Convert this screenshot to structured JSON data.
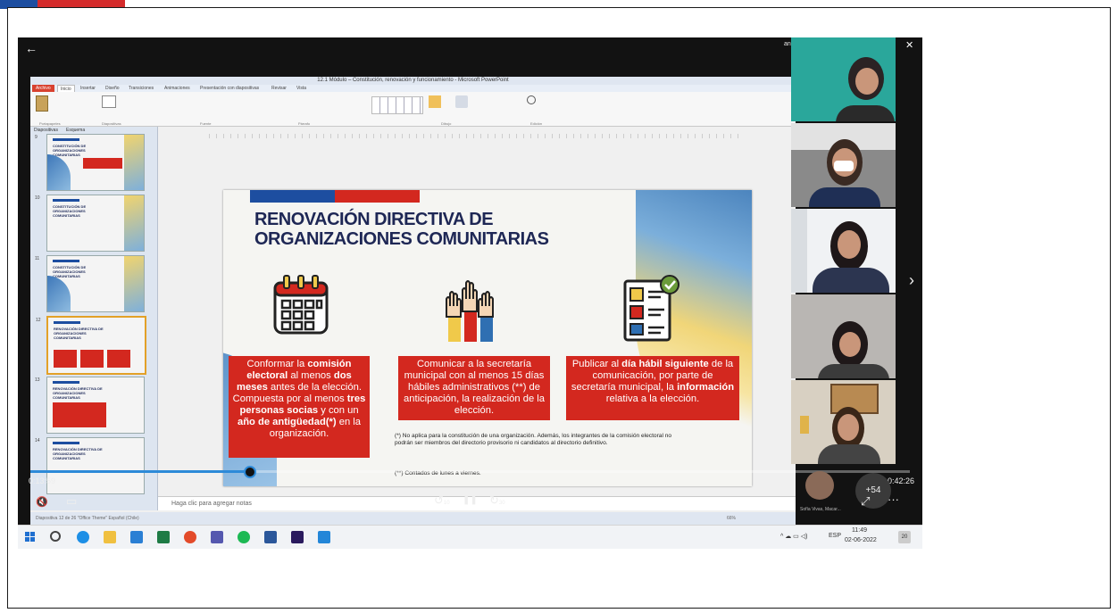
{
  "player": {
    "back_label": "←",
    "current_time": "0:13:59",
    "duration": "0:42:26",
    "progress": 0.25,
    "window_title_partial": "ansmitiendo...pantalla y la cámara",
    "chevron": "›",
    "participant_name": "Sofía Vivas, Macar...",
    "overflow_count": "+54",
    "more_label": "···",
    "ctrl_mute": "🔇",
    "ctrl_captions": "▭",
    "ctrl_rewind": "↺",
    "ctrl_rewind_label": "10",
    "ctrl_pause": "❚❚",
    "ctrl_forward": "↻",
    "ctrl_forward_label": "30",
    "ctrl_expand": "⤢",
    "win_minimize": "—",
    "win_maximize": "❐",
    "win_close": "✕"
  },
  "ppt": {
    "window_title": "12.1 Módulo – Constitución, renovación y funcionamiento  -  Microsoft PowerPoint",
    "tabs": [
      "Archivo",
      "Inicio",
      "Insertar",
      "Diseño",
      "Transiciones",
      "Animaciones",
      "Presentación con diapositivas",
      "Revisar",
      "Vista"
    ],
    "ribbon_groups": [
      "Portapapeles",
      "Diapositivas",
      "Fuente",
      "Párrafo",
      "Dibujo",
      "Edición"
    ],
    "panel_tabs": [
      "Diapositivas",
      "Esquema"
    ],
    "thumbs": [
      {
        "num": "9",
        "title": "CONSTITUCIÓN DE ORGANIZACIONES COMUNITARIAS"
      },
      {
        "num": "10",
        "title": "CONSTITUCIÓN DE ORGANIZACIONES COMUNITARIAS"
      },
      {
        "num": "11",
        "title": "CONSTITUCIÓN DE ORGANIZACIONES COMUNITARIAS"
      },
      {
        "num": "12",
        "title": "RENOVACIÓN DIRECTIVA DE ORGANIZACIONES COMUNITARIAS"
      },
      {
        "num": "13",
        "title": "RENOVACIÓN DIRECTIVA DE ORGANIZACIONES COMUNITARIAS"
      },
      {
        "num": "14",
        "title": "RENOVACIÓN DIRECTIVA DE ORGANIZACIONES COMUNITARIAS"
      }
    ],
    "notes_placeholder": "Haga clic para agregar notas",
    "status_left": "Diapositiva 12 de 26   \"Office Theme\"   Español (Chile)",
    "status_zoom": "66%"
  },
  "slide": {
    "title_line1": "RENOVACIÓN DIRECTIVA DE",
    "title_line2": "ORGANIZACIONES COMUNITARIAS",
    "box1": {
      "p1": "Conformar la ",
      "b1": "comisión electoral",
      "p2": " al menos ",
      "b2": "dos meses",
      "p3": " antes de la elección. Compuesta por al menos ",
      "b3": "tres personas socias",
      "p4": " y con un ",
      "b4": "año de antigüedad(*)",
      "p5": " en la organización."
    },
    "box2": "Comunicar a la secretaría municipal con al menos 15 días hábiles administrativos (**) de anticipación, la realización de la elección.",
    "box3": {
      "p1": "Publicar al ",
      "b1": "día hábil siguiente",
      "p2": " de la comunicación, por parte de secretaría municipal, la ",
      "b2": "información",
      "p3": " relativa a la elección."
    },
    "note1": "(*) No aplica para la constitución de una organización. Además, los integrantes de la comisión electoral no podrán ser miembros del directorio provisorio ni candidatos al directorio definitivo.",
    "note2": "(**) Contados de lunes a viernes."
  },
  "taskbar": {
    "time": "11:49",
    "date": "02-06-2022",
    "lang": "ESP",
    "notif_count": "20"
  },
  "colors": {
    "slide_red": "#d3281f",
    "slide_blue": "#1d4ea0",
    "title_navy": "#1e2755",
    "progress_blue": "#2d8ad8",
    "teal_bg": "#2aa79b"
  }
}
